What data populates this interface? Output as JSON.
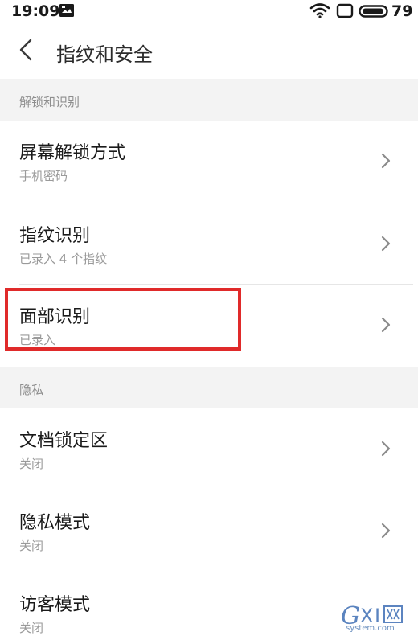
{
  "status_bar": {
    "time": "19:09",
    "battery": "79",
    "icons": [
      "message-icon",
      "wifi-icon",
      "square-icon",
      "battery-icon"
    ]
  },
  "header": {
    "title": "指纹和安全",
    "back_icon": "chevron-left-icon"
  },
  "sections": [
    {
      "label": "解锁和识别",
      "items": [
        {
          "title": "屏幕解锁方式",
          "subtitle": "手机密码"
        },
        {
          "title": "指纹识别",
          "subtitle": "已录入 4 个指纹"
        },
        {
          "title": "面部识别",
          "subtitle": "已录入"
        }
      ]
    },
    {
      "label": "隐私",
      "items": [
        {
          "title": "文档锁定区",
          "subtitle": "关闭"
        },
        {
          "title": "隐私模式",
          "subtitle": "关闭"
        },
        {
          "title": "访客模式",
          "subtitle": "关闭"
        }
      ]
    }
  ],
  "colors": {
    "highlight": "#e02a2a",
    "section_bg": "#f3f3f3",
    "subtitle": "#9a9a9a",
    "watermark": "#3f6fb5"
  },
  "watermark": {
    "brand": "GXI网",
    "domain": "system.com"
  }
}
